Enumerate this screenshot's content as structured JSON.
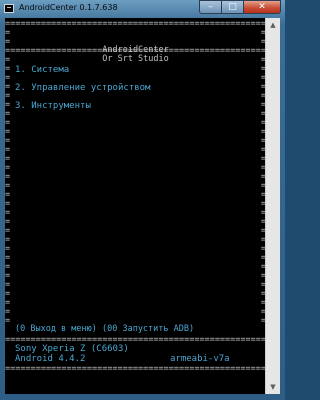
{
  "window": {
    "title": "AndroidCenter 0.1.7.638",
    "close_glyph": "✕",
    "min_glyph": "–",
    "max_glyph": "□"
  },
  "header": {
    "line1": "AndroidCenter",
    "line2": "Or Srt Studio"
  },
  "menu": {
    "items": [
      {
        "label": "1. Система"
      },
      {
        "label": "2. Управление устройством"
      },
      {
        "label": "3. Инструменты"
      }
    ]
  },
  "footer": {
    "commands": "(0 Выход в меню)  (00 Запустить ADB)",
    "device_name": "Sony Xperia Z (C6603)",
    "android_version": "Android 4.4.2",
    "abi": "armeabi-v7a"
  },
  "border": {
    "eq_line": "=========================================================",
    "side": "="
  }
}
